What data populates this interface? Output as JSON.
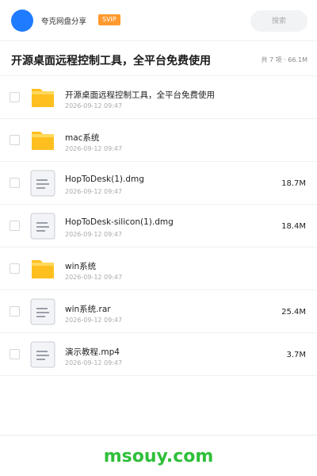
{
  "header": {
    "share_name": "夸克网盘分享",
    "badge": "SVIP",
    "search_placeholder": "搜索"
  },
  "title": {
    "text": "开源桌面远程控制工具，全平台免费使用",
    "meta": "共 7 项 · 66.1M"
  },
  "files": [
    {
      "name": "开源桌面远程控制工具，全平台免费使用",
      "date": "2026-09-12 09:47",
      "size": "",
      "type": "folder"
    },
    {
      "name": "mac系统",
      "date": "2026-09-12 09:47",
      "size": "",
      "type": "folder"
    },
    {
      "name": "HopToDesk(1).dmg",
      "date": "2026-09-12 09:47",
      "size": "18.7M",
      "type": "file"
    },
    {
      "name": "HopToDesk-silicon(1).dmg",
      "date": "2026-09-12 09:47",
      "size": "18.4M",
      "type": "file"
    },
    {
      "name": "win系统",
      "date": "2026-09-12 09:47",
      "size": "",
      "type": "folder"
    },
    {
      "name": "win系统.rar",
      "date": "2026-09-12 09:47",
      "size": "25.4M",
      "type": "file"
    },
    {
      "name": "演示教程.mp4",
      "date": "2026-09-12 09:47",
      "size": "3.7M",
      "type": "file"
    }
  ],
  "footer": {
    "watermark": "msouy.com"
  },
  "colors": {
    "accent": "#1f7bff",
    "badge": "#ff9a2e",
    "folder": "#ffc01f",
    "watermark": "#2fbf3a"
  }
}
